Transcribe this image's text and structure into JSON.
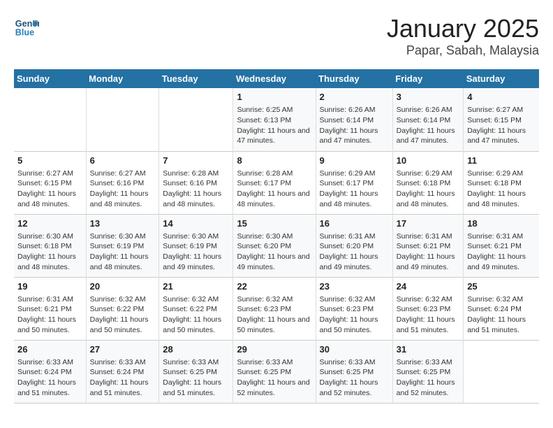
{
  "logo": {
    "line1": "General",
    "line2": "Blue"
  },
  "title": "January 2025",
  "subtitle": "Papar, Sabah, Malaysia",
  "days_of_week": [
    "Sunday",
    "Monday",
    "Tuesday",
    "Wednesday",
    "Thursday",
    "Friday",
    "Saturday"
  ],
  "weeks": [
    [
      {
        "day": "",
        "info": ""
      },
      {
        "day": "",
        "info": ""
      },
      {
        "day": "",
        "info": ""
      },
      {
        "day": "1",
        "sunrise": "6:25 AM",
        "sunset": "6:13 PM",
        "daylight": "11 hours and 47 minutes."
      },
      {
        "day": "2",
        "sunrise": "6:26 AM",
        "sunset": "6:14 PM",
        "daylight": "11 hours and 47 minutes."
      },
      {
        "day": "3",
        "sunrise": "6:26 AM",
        "sunset": "6:14 PM",
        "daylight": "11 hours and 47 minutes."
      },
      {
        "day": "4",
        "sunrise": "6:27 AM",
        "sunset": "6:15 PM",
        "daylight": "11 hours and 47 minutes."
      }
    ],
    [
      {
        "day": "5",
        "sunrise": "6:27 AM",
        "sunset": "6:15 PM",
        "daylight": "11 hours and 48 minutes."
      },
      {
        "day": "6",
        "sunrise": "6:27 AM",
        "sunset": "6:16 PM",
        "daylight": "11 hours and 48 minutes."
      },
      {
        "day": "7",
        "sunrise": "6:28 AM",
        "sunset": "6:16 PM",
        "daylight": "11 hours and 48 minutes."
      },
      {
        "day": "8",
        "sunrise": "6:28 AM",
        "sunset": "6:17 PM",
        "daylight": "11 hours and 48 minutes."
      },
      {
        "day": "9",
        "sunrise": "6:29 AM",
        "sunset": "6:17 PM",
        "daylight": "11 hours and 48 minutes."
      },
      {
        "day": "10",
        "sunrise": "6:29 AM",
        "sunset": "6:18 PM",
        "daylight": "11 hours and 48 minutes."
      },
      {
        "day": "11",
        "sunrise": "6:29 AM",
        "sunset": "6:18 PM",
        "daylight": "11 hours and 48 minutes."
      }
    ],
    [
      {
        "day": "12",
        "sunrise": "6:30 AM",
        "sunset": "6:18 PM",
        "daylight": "11 hours and 48 minutes."
      },
      {
        "day": "13",
        "sunrise": "6:30 AM",
        "sunset": "6:19 PM",
        "daylight": "11 hours and 48 minutes."
      },
      {
        "day": "14",
        "sunrise": "6:30 AM",
        "sunset": "6:19 PM",
        "daylight": "11 hours and 49 minutes."
      },
      {
        "day": "15",
        "sunrise": "6:30 AM",
        "sunset": "6:20 PM",
        "daylight": "11 hours and 49 minutes."
      },
      {
        "day": "16",
        "sunrise": "6:31 AM",
        "sunset": "6:20 PM",
        "daylight": "11 hours and 49 minutes."
      },
      {
        "day": "17",
        "sunrise": "6:31 AM",
        "sunset": "6:21 PM",
        "daylight": "11 hours and 49 minutes."
      },
      {
        "day": "18",
        "sunrise": "6:31 AM",
        "sunset": "6:21 PM",
        "daylight": "11 hours and 49 minutes."
      }
    ],
    [
      {
        "day": "19",
        "sunrise": "6:31 AM",
        "sunset": "6:21 PM",
        "daylight": "11 hours and 50 minutes."
      },
      {
        "day": "20",
        "sunrise": "6:32 AM",
        "sunset": "6:22 PM",
        "daylight": "11 hours and 50 minutes."
      },
      {
        "day": "21",
        "sunrise": "6:32 AM",
        "sunset": "6:22 PM",
        "daylight": "11 hours and 50 minutes."
      },
      {
        "day": "22",
        "sunrise": "6:32 AM",
        "sunset": "6:23 PM",
        "daylight": "11 hours and 50 minutes."
      },
      {
        "day": "23",
        "sunrise": "6:32 AM",
        "sunset": "6:23 PM",
        "daylight": "11 hours and 50 minutes."
      },
      {
        "day": "24",
        "sunrise": "6:32 AM",
        "sunset": "6:23 PM",
        "daylight": "11 hours and 51 minutes."
      },
      {
        "day": "25",
        "sunrise": "6:32 AM",
        "sunset": "6:24 PM",
        "daylight": "11 hours and 51 minutes."
      }
    ],
    [
      {
        "day": "26",
        "sunrise": "6:33 AM",
        "sunset": "6:24 PM",
        "daylight": "11 hours and 51 minutes."
      },
      {
        "day": "27",
        "sunrise": "6:33 AM",
        "sunset": "6:24 PM",
        "daylight": "11 hours and 51 minutes."
      },
      {
        "day": "28",
        "sunrise": "6:33 AM",
        "sunset": "6:25 PM",
        "daylight": "11 hours and 51 minutes."
      },
      {
        "day": "29",
        "sunrise": "6:33 AM",
        "sunset": "6:25 PM",
        "daylight": "11 hours and 52 minutes."
      },
      {
        "day": "30",
        "sunrise": "6:33 AM",
        "sunset": "6:25 PM",
        "daylight": "11 hours and 52 minutes."
      },
      {
        "day": "31",
        "sunrise": "6:33 AM",
        "sunset": "6:25 PM",
        "daylight": "11 hours and 52 minutes."
      },
      {
        "day": "",
        "info": ""
      }
    ]
  ]
}
